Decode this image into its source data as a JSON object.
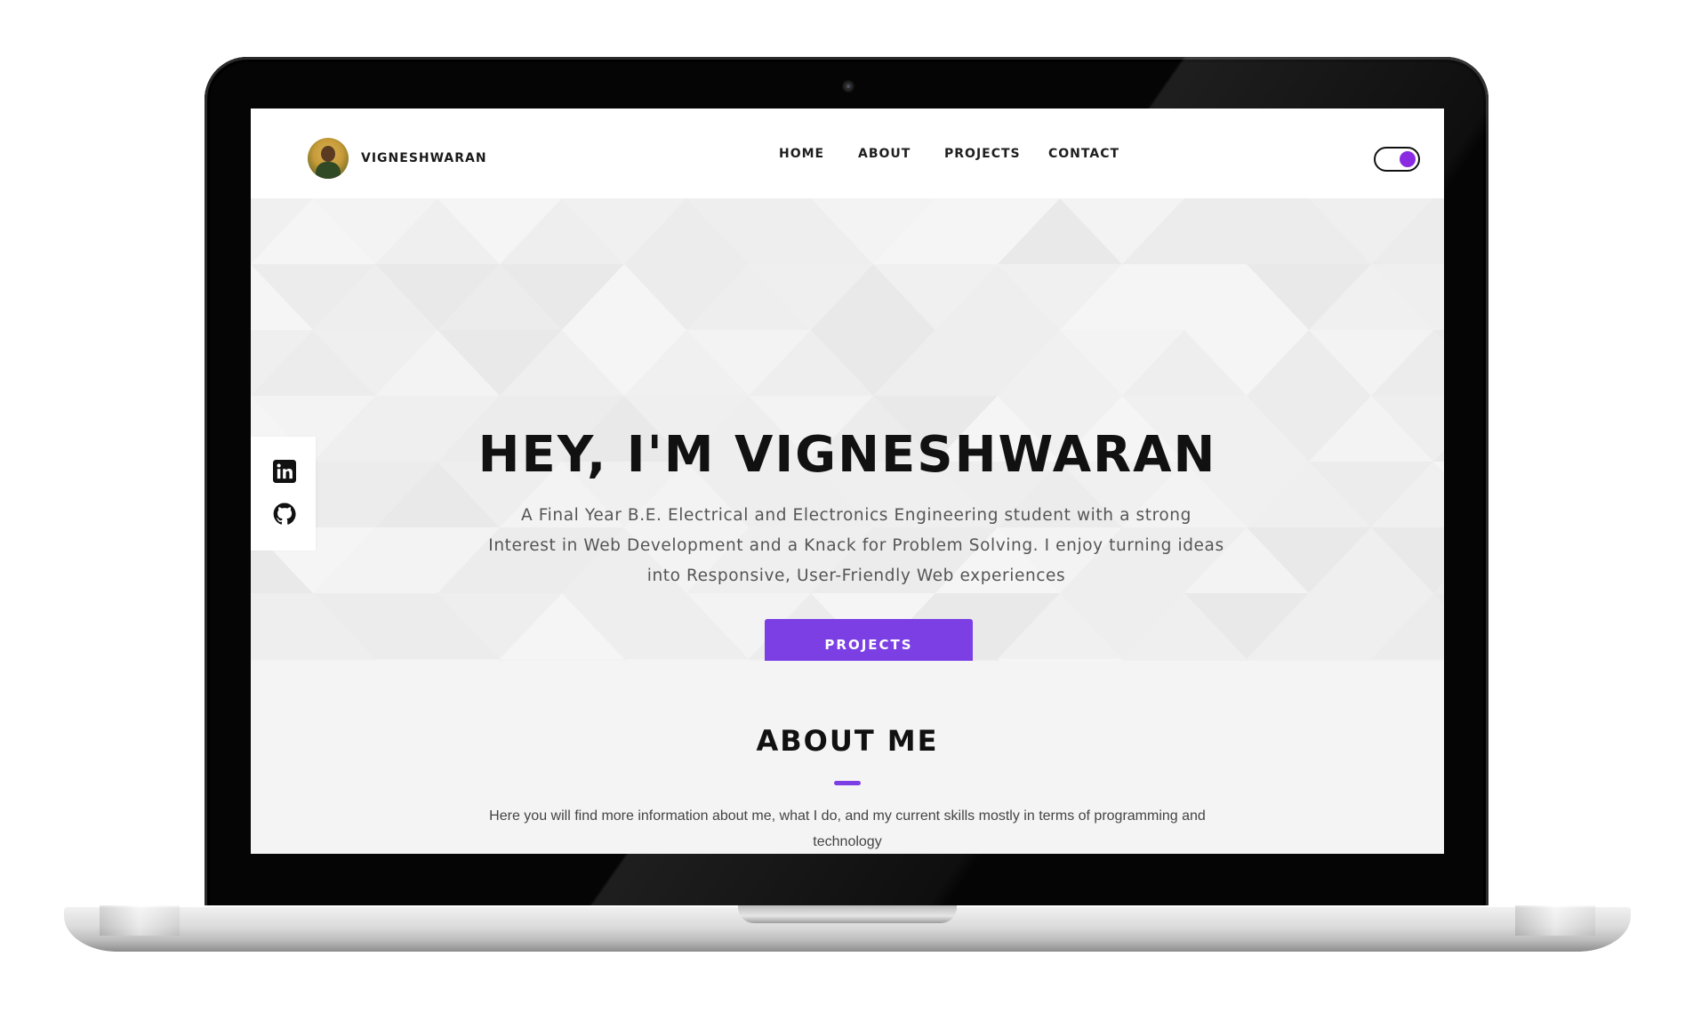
{
  "header": {
    "brand_name": "VIGNESHWARAN",
    "nav": [
      "HOME",
      "ABOUT",
      "PROJECTS",
      "CONTACT"
    ],
    "theme_toggle_on": true
  },
  "social": [
    "linkedin-icon",
    "github-icon"
  ],
  "hero": {
    "title": "HEY, I'M VIGNESHWARAN",
    "description": "A Final Year B.E. Electrical and Electronics Engineering student with a strong Interest in Web Development and a Knack for Problem Solving. I enjoy turning ideas into Responsive, User-Friendly Web experiences",
    "cta_label": "PROJECTS"
  },
  "about": {
    "title": "ABOUT ME",
    "description": "Here you will find more information about me, what I do, and my current skills mostly in terms of programming and technology"
  },
  "colors": {
    "accent": "#7b3fe4",
    "toggle_knob": "#8a2be2",
    "text_dark": "#111111",
    "hero_bg": "#f2f2f2"
  }
}
